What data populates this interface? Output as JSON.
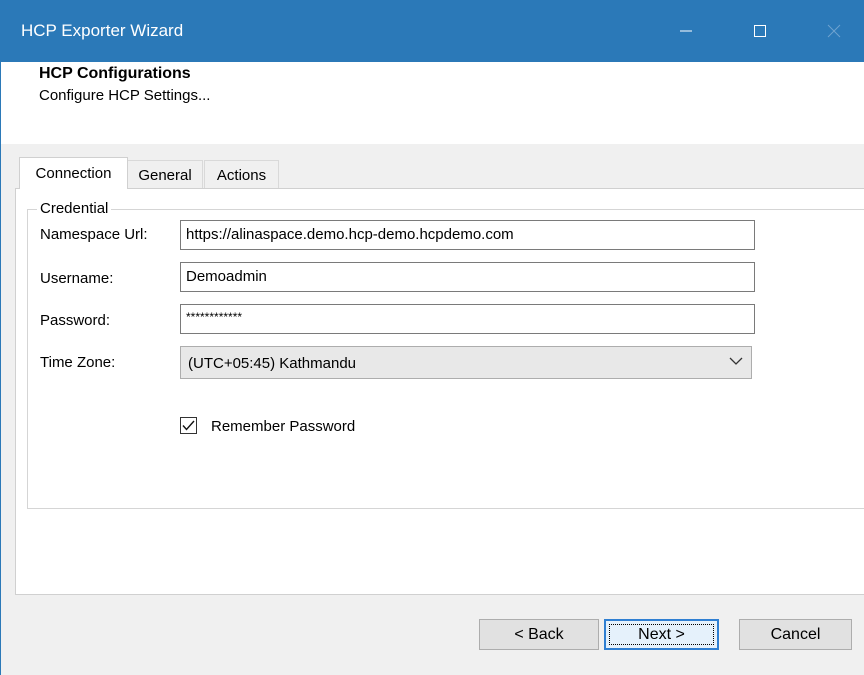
{
  "window": {
    "title": "HCP Exporter Wizard",
    "accent": "#2b79b8",
    "controls": [
      "minimize-icon",
      "maximize-icon",
      "close-icon"
    ]
  },
  "header": {
    "title": "HCP Configurations",
    "subtitle": "Configure HCP Settings..."
  },
  "tabs": [
    {
      "label": "Connection",
      "active": true
    },
    {
      "label": "General",
      "active": false
    },
    {
      "label": "Actions",
      "active": false
    }
  ],
  "credential": {
    "legend": "Credential",
    "namespace_label": "Namespace Url:",
    "namespace_value": "https://alinaspace.demo.hcp-demo.hcpdemo.com",
    "username_label": "Username:",
    "username_value": "Demoadmin",
    "password_label": "Password:",
    "password_value": "************",
    "timezone_label": "Time Zone:",
    "timezone_value": "(UTC+05:45) Kathmandu",
    "remember_label": "Remember Password",
    "remember_checked": true
  },
  "buttons": {
    "back": "< Back",
    "next": "Next >",
    "cancel": "Cancel"
  }
}
